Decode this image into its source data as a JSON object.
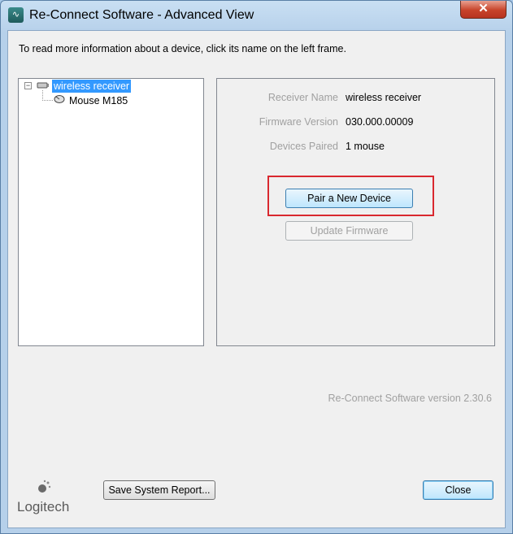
{
  "window": {
    "title": "Re-Connect Software - Advanced View",
    "close_glyph": "✕"
  },
  "info": {
    "text": "To read more information about a device, click its name on the left frame."
  },
  "tree": {
    "expander": "−",
    "items": [
      {
        "label": "wireless receiver",
        "icon": "receiver-icon",
        "selected": true
      },
      {
        "label": "Mouse M185",
        "icon": "mouse-icon",
        "selected": false
      }
    ]
  },
  "details": {
    "rows": [
      {
        "label": "Receiver Name",
        "value": "wireless receiver"
      },
      {
        "label": "Firmware Version",
        "value": "030.000.00009"
      },
      {
        "label": "Devices Paired",
        "value": "1 mouse"
      }
    ],
    "pair_button": "Pair a New Device",
    "update_button": "Update Firmware"
  },
  "footer": {
    "version_text": "Re-Connect Software version 2.30.6",
    "logo_text": "Logitech",
    "report_button": "Save System Report...",
    "close_button": "Close"
  },
  "colors": {
    "selection": "#3399ff",
    "highlight_box": "#d9282f",
    "accent": "#3c7fb1"
  }
}
